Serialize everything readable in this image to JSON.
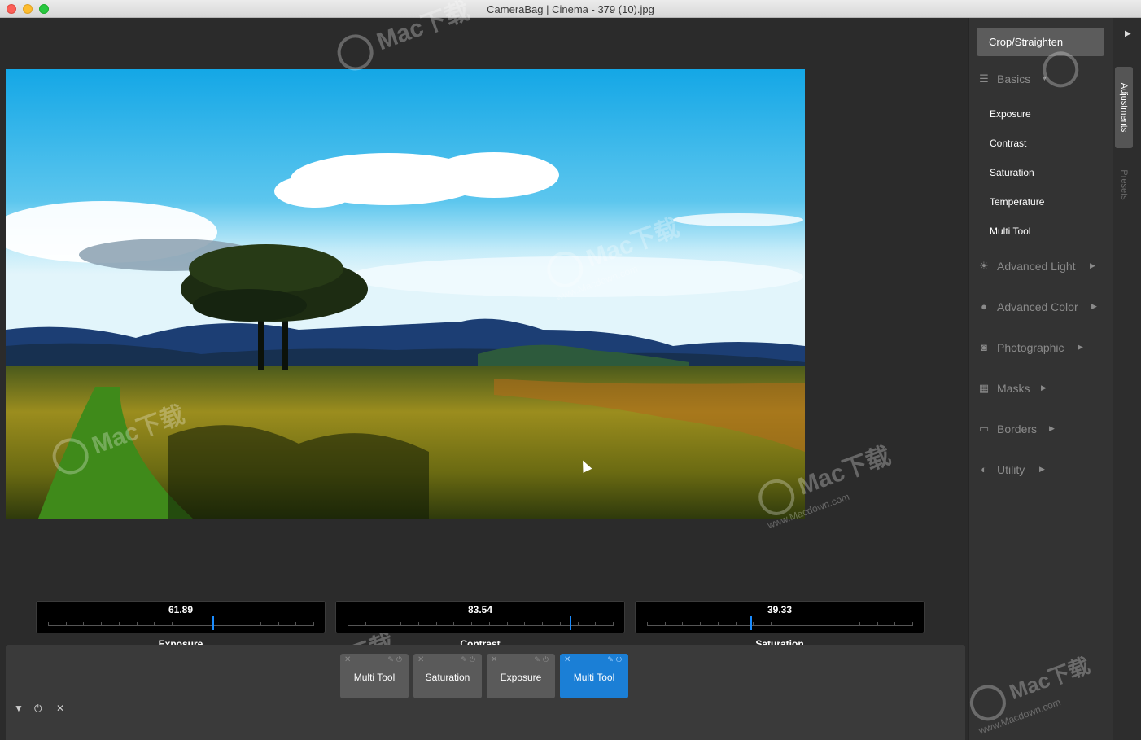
{
  "window": {
    "title": "CameraBag | Cinema - 379 (10).jpg"
  },
  "photo": {
    "description_alt": "Landscape photo with tree on grassy moorland under blue sky"
  },
  "sliders": [
    {
      "label": "Exposure",
      "value": "61.89",
      "fraction": 0.62
    },
    {
      "label": "Contrast",
      "value": "83.54",
      "fraction": 0.835
    },
    {
      "label": "Saturation",
      "value": "39.33",
      "fraction": 0.39
    }
  ],
  "strip": {
    "chips": [
      {
        "label": "Multi Tool",
        "active": false
      },
      {
        "label": "Saturation",
        "active": false
      },
      {
        "label": "Exposure",
        "active": false
      },
      {
        "label": "Multi Tool",
        "active": true
      }
    ],
    "controls": {
      "collapse": "▼",
      "power": "⏻",
      "close": "✕"
    }
  },
  "panel": {
    "crop_label": "Crop/Straighten",
    "basics": {
      "label": "Basics",
      "icon": "sliders-icon",
      "items": [
        "Exposure",
        "Contrast",
        "Saturation",
        "Temperature",
        "Multi Tool"
      ]
    },
    "sections": [
      {
        "label": "Advanced Light",
        "icon": "sun-icon"
      },
      {
        "label": "Advanced Color",
        "icon": "palette-icon"
      },
      {
        "label": "Photographic",
        "icon": "camera-icon"
      },
      {
        "label": "Masks",
        "icon": "mask-icon"
      },
      {
        "label": "Borders",
        "icon": "border-icon"
      },
      {
        "label": "Utility",
        "icon": "utility-icon"
      }
    ]
  },
  "tabs": {
    "adjustments": "Adjustments",
    "presets": "Presets"
  },
  "watermark": {
    "brand": "Mac下载",
    "url": "www.Macdown.com"
  }
}
